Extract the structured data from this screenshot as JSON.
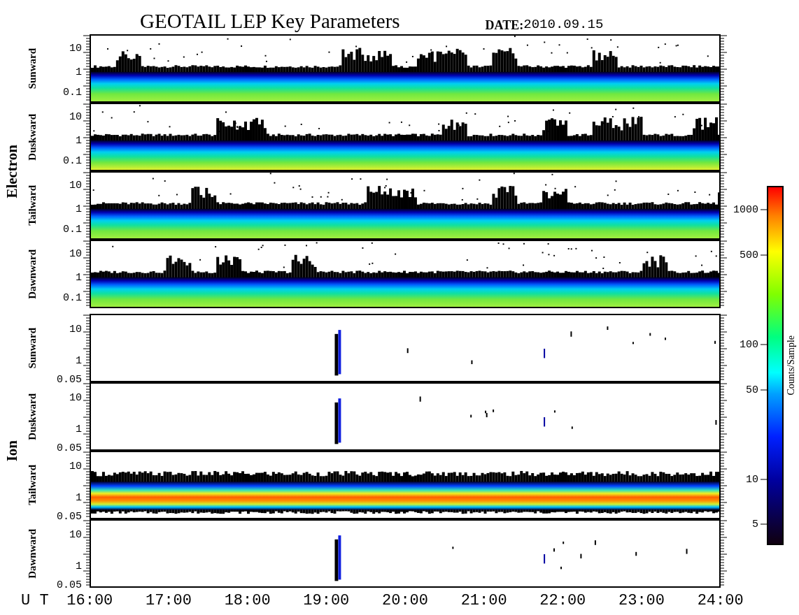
{
  "title": "GEOTAIL LEP Key Parameters",
  "date": {
    "label": "DATE:",
    "value": "2010.09.15"
  },
  "groups": [
    {
      "name": "Electron",
      "panels": [
        {
          "direction": "Sunward",
          "kind": "flux",
          "ticks": [
            "10",
            "1",
            "0.1"
          ]
        },
        {
          "direction": "Duskward",
          "kind": "flux",
          "ticks": [
            "10",
            "1",
            "0.1"
          ]
        },
        {
          "direction": "Tailward",
          "kind": "flux",
          "ticks": [
            "10",
            "1",
            "0.1"
          ]
        },
        {
          "direction": "Dawnward",
          "kind": "flux",
          "ticks": [
            "10",
            "1",
            "0.1"
          ]
        }
      ]
    },
    {
      "name": "Ion",
      "panels": [
        {
          "direction": "Sunward",
          "kind": "sparse",
          "ticks": [
            "10",
            "1",
            "0.05"
          ]
        },
        {
          "direction": "Duskward",
          "kind": "sparse",
          "ticks": [
            "10",
            "1",
            "0.05"
          ]
        },
        {
          "direction": "Tailward",
          "kind": "band",
          "ticks": [
            "10",
            "1",
            "0.05"
          ]
        },
        {
          "direction": "Dawnward",
          "kind": "sparse",
          "ticks": [
            "10",
            "1",
            "0.05"
          ]
        }
      ]
    }
  ],
  "colorbar": {
    "label": "Counts/Sample",
    "ticks": [
      "1000",
      "500",
      "100",
      "50",
      "10",
      "5"
    ]
  },
  "x_axis": {
    "label": "U T",
    "ticks": [
      "16:00",
      "17:00",
      "18:00",
      "19:00",
      "20:00",
      "21:00",
      "22:00",
      "23:00",
      "24:00"
    ]
  }
}
